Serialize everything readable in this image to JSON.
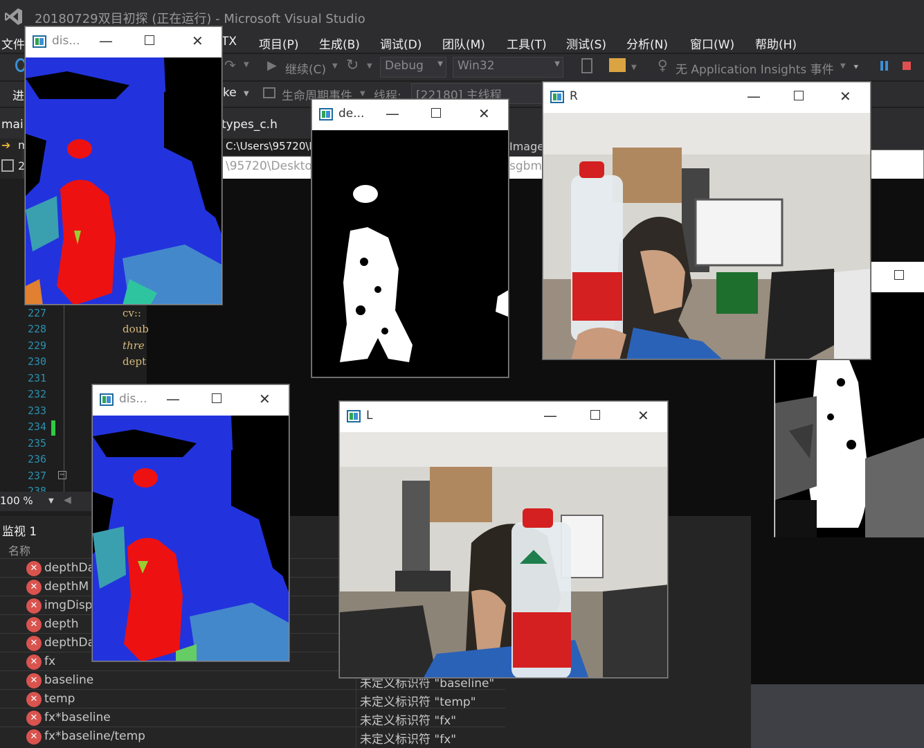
{
  "app": {
    "title": "20180729双目初探 (正在运行) - Microsoft Visual Studio",
    "menu": [
      "文件",
      "TX",
      "项目(P)",
      "生成(B)",
      "调试(D)",
      "团队(M)",
      "工具(T)",
      "测试(S)",
      "分析(N)",
      "窗口(W)",
      "帮助(H)"
    ],
    "toolbar1": {
      "continue": "继续(C)",
      "config": "Debug",
      "platform": "Win32",
      "insights": "无 Application Insights 事件"
    },
    "toolbar2": {
      "process_label": "进",
      "ke": "ke",
      "lifecycle": "生命周期事件",
      "thread_label": "线程:",
      "thread_value": "[22180] 主线程"
    },
    "tabs": {
      "main": "mair",
      "types": "types_c.h",
      "path1": "C:\\Users\\95720\\D",
      "path2": "\\95720\\Desktop",
      "image": "Image",
      "sgbm": "sgbm\\"
    },
    "left_icons": [
      "m",
      "2"
    ],
    "line_numbers": [
      "227",
      "228",
      "229",
      "230",
      "231",
      "232",
      "233",
      "234",
      "235",
      "236",
      "237",
      "238"
    ],
    "code_lines": [
      "cv::",
      "doub",
      "thre",
      "dept"
    ],
    "zoom": "100 %",
    "watch": {
      "title": "监视 1",
      "header_name": "名称",
      "rows": [
        {
          "name": "depthDa",
          "value": ""
        },
        {
          "name": "depthM",
          "value": ""
        },
        {
          "name": "imgDisp",
          "value": ""
        },
        {
          "name": "depth",
          "value": ""
        },
        {
          "name": "depthDa",
          "value": ""
        },
        {
          "name": "fx",
          "value": ""
        },
        {
          "name": "baseline",
          "value": "未定义标识符 \"baseline\""
        },
        {
          "name": "temp",
          "value": "未定义标识符 \"temp\""
        },
        {
          "name": "fx*baseline",
          "value": "未定义标识符 \"fx\""
        },
        {
          "name": "fx*baseline/temp",
          "value": "未定义标识符 \"fx\""
        }
      ]
    }
  },
  "windows": {
    "disp1": {
      "title": "dis..."
    },
    "depth": {
      "title": "de..."
    },
    "right": {
      "title": "R"
    },
    "disp2": {
      "title": "dis..."
    },
    "left": {
      "title": "L"
    }
  },
  "colors": {
    "vs_bg": "#2d2d30",
    "editor_bg": "#1e1e1e",
    "disp_blue": "#2233dd",
    "disp_red": "#ee1111",
    "disp_teal": "#3aa0b0",
    "error_red": "#d9534f",
    "line_number": "#2b91af"
  }
}
